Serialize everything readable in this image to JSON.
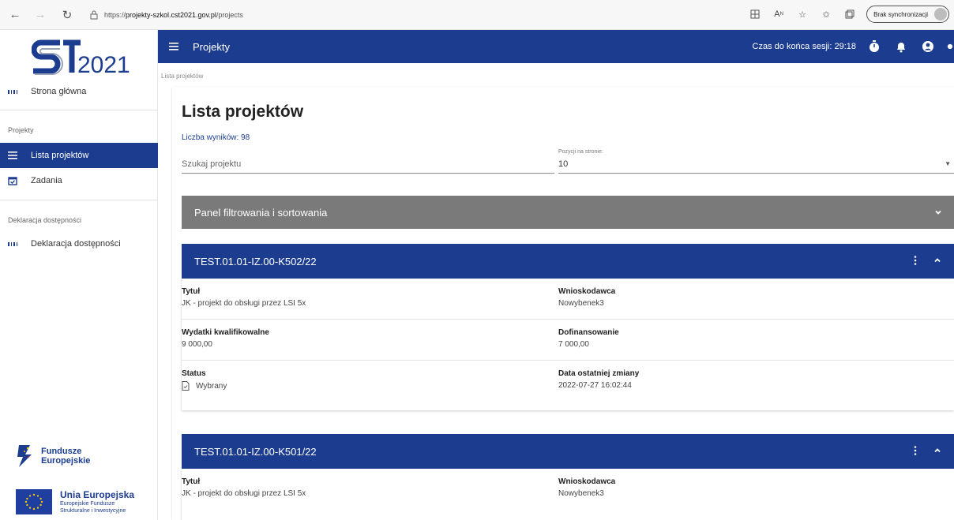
{
  "browser": {
    "url_prefix": "https://",
    "url_host": "projekty-szkol.cst2021.gov.pl",
    "url_path": "/projects",
    "sync_label": "Brak synchronizacji"
  },
  "sidebar": {
    "logo_text": "2021",
    "home": "Strona główna",
    "section_projects": "Projekty",
    "items": [
      {
        "label": "Lista projektów"
      },
      {
        "label": "Zadania"
      }
    ],
    "section_access": "Deklaracja dostępności",
    "access_item": "Deklaracja dostępności",
    "fe_line1": "Fundusze",
    "fe_line2": "Europejskie",
    "ue_title": "Unia Europejska",
    "ue_sub1": "Europejskie Fundusze",
    "ue_sub2": "Strukturalne i Inwestycyjne"
  },
  "appbar": {
    "title": "Projekty",
    "session": "Czas do końca sesji: 29:18"
  },
  "main": {
    "breadcrumb": "Lista projektów",
    "title": "Lista projektów",
    "results": "Liczba wyników: 98",
    "search_placeholder": "Szukaj projektu",
    "per_page_label": "Pozycji na stronie:",
    "per_page_value": "10",
    "filter_panel": "Panel filtrowania i sortowania"
  },
  "projects": [
    {
      "id": "TEST.01.01-IZ.00-K502/22",
      "title_label": "Tytuł",
      "title": "JK - projekt do obsługi przez LSI 5x",
      "applicant_label": "Wnioskodawca",
      "applicant": "Nowybenek3",
      "expenses_label": "Wydatki kwalifikowalne",
      "expenses": "9 000,00",
      "funding_label": "Dofinansowanie",
      "funding": "7 000,00",
      "status_label": "Status",
      "status": "Wybrany",
      "changed_label": "Data ostatniej zmiany",
      "changed": "2022-07-27 16:02:44"
    },
    {
      "id": "TEST.01.01-IZ.00-K501/22",
      "title_label": "Tytuł",
      "title": "JK - projekt do obsługi przez LSI 5x",
      "applicant_label": "Wnioskodawca",
      "applicant": "Nowybenek3"
    }
  ]
}
